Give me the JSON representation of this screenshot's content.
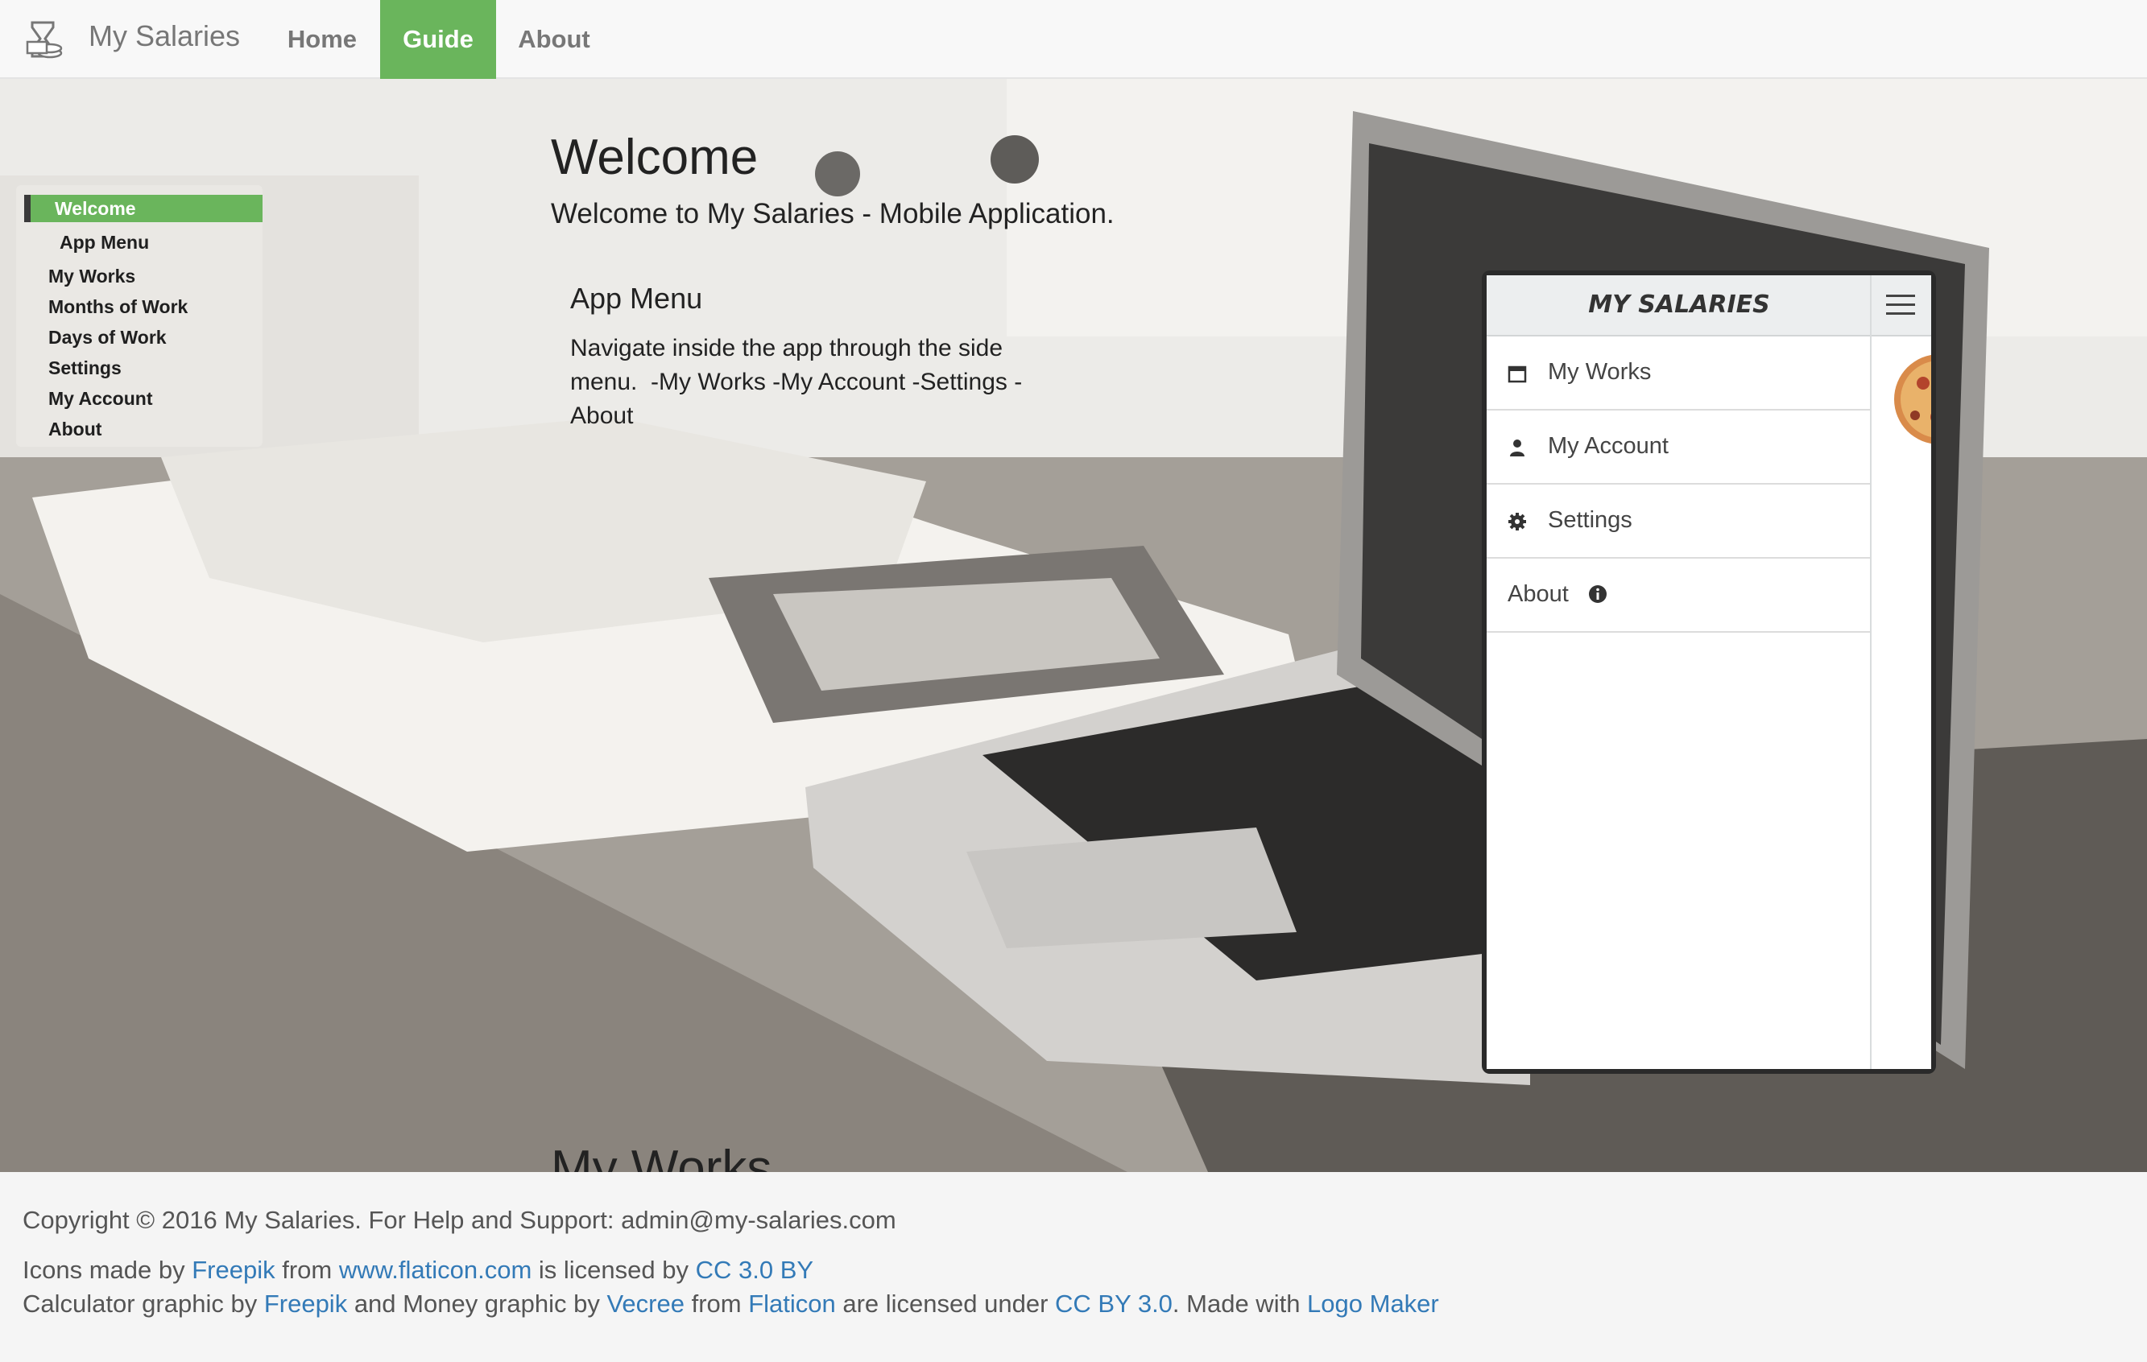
{
  "navbar": {
    "brand": "My Salaries",
    "items": [
      {
        "label": "Home",
        "active": false
      },
      {
        "label": "Guide",
        "active": true
      },
      {
        "label": "About",
        "active": false
      }
    ]
  },
  "sidenav": {
    "items": [
      "Welcome",
      "App Menu",
      "My Works",
      "Months of Work",
      "Days of Work",
      "Settings",
      "My Account",
      "About"
    ],
    "active_index": 0
  },
  "content": {
    "title": "Welcome",
    "subtitle": "Welcome to My Salaries - Mobile Application.",
    "section_title": "App Menu",
    "section_text": "Navigate inside the app through the side menu.  -My Works -My Account -Settings -About",
    "next_title": "My Works"
  },
  "phone": {
    "app_title": "MY SALARIES",
    "menu": [
      {
        "label": "My Works",
        "icon": "calendar-icon"
      },
      {
        "label": "My Account",
        "icon": "user-icon"
      },
      {
        "label": "Settings",
        "icon": "gear-icon"
      },
      {
        "label": "About",
        "icon": "info-icon"
      }
    ]
  },
  "footer": {
    "copyright": "Copyright © 2016 My Salaries. For Help and Support: admin@my-salaries.com",
    "icons": {
      "t1": "Icons made by ",
      "l1": "Freepik",
      "t2": " from ",
      "l2": "www.flaticon.com",
      "t3": " is licensed by ",
      "l3": "CC 3.0 BY"
    },
    "credits": {
      "t1": "Calculator graphic by ",
      "l1": "Freepik",
      "t2": " and Money graphic by ",
      "l2": "Vecree",
      "t3": " from ",
      "l3": "Flaticon",
      "t4": " are licensed under ",
      "l4": "CC BY 3.0",
      "t5": ". Made with ",
      "l5": "Logo Maker"
    }
  },
  "colors": {
    "accent": "#6ab55c",
    "link": "#337ab7"
  }
}
